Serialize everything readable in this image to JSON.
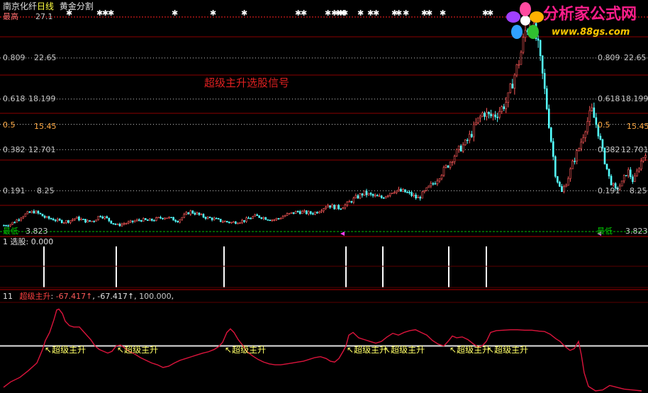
{
  "header": {
    "stock": "南京化纤",
    "period": "日线",
    "indicator": "黄金分割"
  },
  "watermark": {
    "title": "分析家公式网",
    "url": "www.88gs.com"
  },
  "panel1": {
    "center_label": "超级主升选股信号",
    "top_label": "最高",
    "top_value": "27.1",
    "bottom_label": "最低",
    "bottom_value": "3.823",
    "fib_levels": [
      {
        "ratio": "0.809",
        "price": "22.65"
      },
      {
        "ratio": "0.618",
        "price": "18.199"
      },
      {
        "ratio": "0.5",
        "price": "15.45"
      },
      {
        "ratio": "0.382",
        "price": "12.701"
      },
      {
        "ratio": "0.191",
        "price": "8.25"
      }
    ]
  },
  "panel2": {
    "index": "1",
    "label": "选股",
    "value": "0.000"
  },
  "panel3": {
    "index": "11",
    "name": "超级主升",
    "v1": "-67.417",
    "v2": "-67.417",
    "v3": "100.000",
    "arrow": "↑",
    "signal_label": "超级主升"
  },
  "colors": {
    "background": "#000000",
    "up": "#ff5a5a",
    "down": "#54ffff",
    "grid_red": "#8b0000",
    "fib_line": "#c8c8c8",
    "low_line": "#00c000",
    "indicator": "#dc143c",
    "signal": "#ffff66",
    "axis_text": "#c8c8c8"
  },
  "chart_data": [
    {
      "type": "candlestick",
      "title": "黄金分割",
      "ylim": [
        3.823,
        27.1
      ],
      "close_path": [
        4.5,
        4.6,
        5.0,
        5.5,
        5.8,
        6.0,
        5.7,
        5.3,
        5.2,
        5.0,
        4.9,
        5.0,
        5.3,
        5.1,
        4.9,
        5.0,
        5.6,
        5.3,
        4.8,
        4.5,
        4.7,
        4.8,
        5.0,
        5.1,
        5.0,
        5.1,
        5.3,
        5.4,
        5.2,
        5.0,
        5.5,
        6.0,
        5.8,
        5.5,
        5.3,
        5.2,
        5.0,
        4.9,
        4.8,
        4.9,
        5.0,
        5.3,
        5.5,
        5.4,
        5.2,
        5.1,
        5.3,
        5.6,
        5.8,
        6.0,
        5.9,
        5.8,
        5.9,
        6.3,
        6.7,
        6.5,
        6.4,
        6.7,
        7.2,
        7.6,
        8.0,
        7.8,
        7.6,
        7.5,
        7.9,
        8.3,
        8.2,
        8.1,
        7.8,
        7.4,
        8.0,
        8.7,
        9.3,
        10.2,
        11.0,
        12.0,
        12.8,
        13.4,
        14.5,
        15.8,
        16.8,
        16.3,
        16.5,
        17.2,
        18.1,
        20.5,
        22.5,
        25.7,
        26.5,
        24.2,
        20.0,
        15.0,
        10.0,
        8.0,
        9.5,
        11.5,
        13.0,
        15.2,
        17.0,
        15.0,
        12.0,
        9.5,
        8.3,
        9.0,
        10.5,
        9.2,
        11.0,
        12.5
      ],
      "signal_idx": [
        15,
        38,
        55,
        62,
        69,
        81,
        88,
        98,
        108,
        118
      ]
    },
    {
      "type": "bar",
      "title": "选股",
      "ylim": [
        0,
        1
      ],
      "signal_x": [
        62,
        164,
        316,
        488,
        540,
        633,
        686
      ],
      "values": [
        1,
        1,
        1,
        1,
        1,
        1,
        1
      ]
    },
    {
      "type": "line",
      "title": "超级主升",
      "ylim": [
        -100,
        100
      ],
      "baseline": 0,
      "series": [
        {
          "name": "超级主升",
          "points": [
            [
              5,
              -92
            ],
            [
              15,
              -80
            ],
            [
              28,
              -70
            ],
            [
              40,
              -55
            ],
            [
              52,
              -38
            ],
            [
              60,
              -8
            ],
            [
              64,
              12
            ],
            [
              70,
              30
            ],
            [
              76,
              58
            ],
            [
              80,
              80
            ],
            [
              83,
              82
            ],
            [
              88,
              72
            ],
            [
              92,
              55
            ],
            [
              98,
              45
            ],
            [
              104,
              42
            ],
            [
              112,
              42
            ],
            [
              120,
              28
            ],
            [
              128,
              14
            ],
            [
              134,
              0
            ],
            [
              140,
              -8
            ],
            [
              146,
              -12
            ],
            [
              152,
              -16
            ],
            [
              158,
              -12
            ],
            [
              164,
              0
            ],
            [
              170,
              2
            ],
            [
              176,
              -5
            ],
            [
              182,
              -12
            ],
            [
              190,
              -18
            ],
            [
              198,
              -26
            ],
            [
              206,
              -32
            ],
            [
              214,
              -38
            ],
            [
              222,
              -42
            ],
            [
              230,
              -48
            ],
            [
              238,
              -45
            ],
            [
              246,
              -38
            ],
            [
              254,
              -32
            ],
            [
              262,
              -28
            ],
            [
              270,
              -24
            ],
            [
              278,
              -20
            ],
            [
              286,
              -16
            ],
            [
              294,
              -13
            ],
            [
              302,
              -8
            ],
            [
              308,
              -2
            ],
            [
              314,
              8
            ],
            [
              320,
              30
            ],
            [
              325,
              38
            ],
            [
              330,
              30
            ],
            [
              336,
              14
            ],
            [
              342,
              2
            ],
            [
              348,
              -12
            ],
            [
              356,
              -22
            ],
            [
              364,
              -30
            ],
            [
              372,
              -36
            ],
            [
              380,
              -40
            ],
            [
              388,
              -42
            ],
            [
              396,
              -42
            ],
            [
              404,
              -40
            ],
            [
              412,
              -38
            ],
            [
              420,
              -36
            ],
            [
              428,
              -34
            ],
            [
              436,
              -30
            ],
            [
              444,
              -26
            ],
            [
              452,
              -24
            ],
            [
              460,
              -28
            ],
            [
              466,
              -34
            ],
            [
              472,
              -36
            ],
            [
              478,
              -28
            ],
            [
              484,
              -12
            ],
            [
              488,
              0
            ],
            [
              492,
              24
            ],
            [
              498,
              30
            ],
            [
              506,
              18
            ],
            [
              514,
              14
            ],
            [
              522,
              10
            ],
            [
              530,
              6
            ],
            [
              538,
              10
            ],
            [
              546,
              20
            ],
            [
              554,
              28
            ],
            [
              562,
              24
            ],
            [
              570,
              30
            ],
            [
              578,
              34
            ],
            [
              586,
              36
            ],
            [
              594,
              30
            ],
            [
              602,
              24
            ],
            [
              610,
              12
            ],
            [
              618,
              4
            ],
            [
              626,
              0
            ],
            [
              632,
              10
            ],
            [
              638,
              22
            ],
            [
              644,
              18
            ],
            [
              652,
              20
            ],
            [
              660,
              14
            ],
            [
              668,
              4
            ],
            [
              674,
              -2
            ],
            [
              680,
              0
            ],
            [
              686,
              10
            ],
            [
              692,
              30
            ],
            [
              700,
              34
            ],
            [
              710,
              35
            ],
            [
              720,
              36
            ],
            [
              730,
              36
            ],
            [
              740,
              35
            ],
            [
              750,
              35
            ],
            [
              760,
              33
            ],
            [
              768,
              32
            ],
            [
              776,
              26
            ],
            [
              784,
              16
            ],
            [
              790,
              10
            ],
            [
              796,
              0
            ],
            [
              804,
              -10
            ],
            [
              810,
              -6
            ],
            [
              816,
              10
            ],
            [
              820,
              -20
            ],
            [
              824,
              -60
            ],
            [
              830,
              -90
            ],
            [
              840,
              -100
            ],
            [
              850,
              -98
            ],
            [
              860,
              -88
            ],
            [
              870,
              -92
            ],
            [
              880,
              -96
            ],
            [
              892,
              -98
            ],
            [
              905,
              -100
            ]
          ]
        }
      ],
      "signal_x": [
        62,
        164,
        316,
        488,
        540,
        633,
        686
      ]
    }
  ]
}
